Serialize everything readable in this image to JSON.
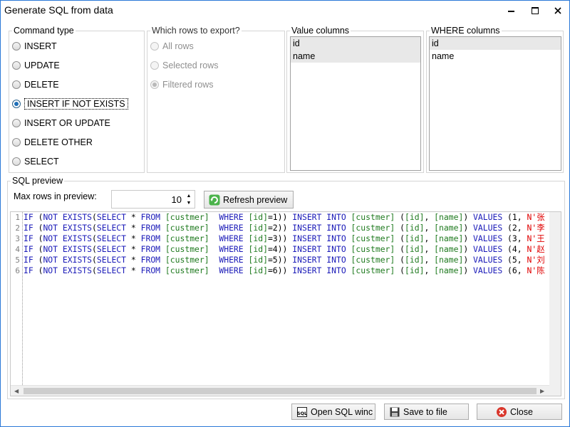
{
  "window": {
    "title": "Generate SQL from data"
  },
  "command_type": {
    "title": "Command type",
    "options": [
      {
        "label": "INSERT",
        "checked": false
      },
      {
        "label": "UPDATE",
        "checked": false
      },
      {
        "label": "DELETE",
        "checked": false
      },
      {
        "label": "INSERT IF NOT EXISTS",
        "checked": true
      },
      {
        "label": "INSERT OR UPDATE",
        "checked": false
      },
      {
        "label": "DELETE OTHER",
        "checked": false
      },
      {
        "label": "SELECT",
        "checked": false
      }
    ]
  },
  "rows_export": {
    "title": "Which rows to export?",
    "options": [
      {
        "label": "All rows",
        "checked": false
      },
      {
        "label": "Selected rows",
        "checked": false
      },
      {
        "label": "Filtered rows",
        "checked": true
      }
    ]
  },
  "value_columns": {
    "title": "Value columns",
    "items": [
      "id",
      "name"
    ]
  },
  "where_columns": {
    "title": "WHERE columns",
    "items": [
      "id",
      "name"
    ]
  },
  "preview": {
    "title": "SQL preview",
    "max_rows_label": "Max rows in preview:",
    "max_rows_value": "10",
    "refresh_label": "Refresh preview",
    "lines": [
      {
        "no": "1",
        "id": "1",
        "values_id": "1",
        "str_tail": "N'张"
      },
      {
        "no": "2",
        "id": "2",
        "values_id": "2",
        "str_tail": "N'李"
      },
      {
        "no": "3",
        "id": "3",
        "values_id": "3",
        "str_tail": "N'王"
      },
      {
        "no": "4",
        "id": "4",
        "values_id": "4",
        "str_tail": "N'赵"
      },
      {
        "no": "5",
        "id": "5",
        "values_id": "5",
        "str_tail": "N'刘"
      },
      {
        "no": "6",
        "id": "6",
        "values_id": "6",
        "str_tail": "N'陈"
      }
    ],
    "sql_tokens": {
      "if": "IF",
      "not_exists": "NOT EXISTS",
      "select": "SELECT",
      "from": "FROM",
      "table": "[custmer]",
      "where": "WHERE",
      "id_col": "[id]",
      "insert_into": "INSERT INTO",
      "cols": "([id], [name])",
      "values": "VALUES"
    }
  },
  "buttons": {
    "open_sql": "Open SQL winc",
    "save_file": "Save to file",
    "close": "Close"
  },
  "colors": {
    "keyword": "#1a1ab8",
    "table": "#1f7a1f",
    "string": "#e00000",
    "window_border": "#2b79d8"
  }
}
